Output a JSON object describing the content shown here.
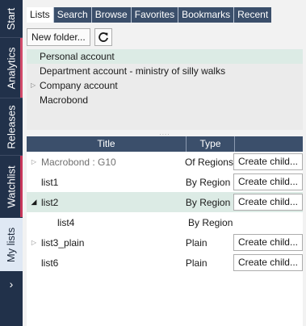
{
  "side_tabs": [
    {
      "label": "Start",
      "accent": ""
    },
    {
      "label": "Analytics",
      "accent": "#d24a6a"
    },
    {
      "label": "Releases",
      "accent": ""
    },
    {
      "label": "Watchlist",
      "accent": "#c7365a"
    },
    {
      "label": "My lists",
      "accent": "",
      "active": true
    }
  ],
  "expand_glyph": "›",
  "tabs": [
    "Lists",
    "Search",
    "Browse",
    "Favorites",
    "Bookmarks",
    "Recent"
  ],
  "active_tab": "Lists",
  "toolbar": {
    "new_folder_label": "New folder...",
    "refresh_icon": "refresh-icon"
  },
  "accounts": [
    {
      "label": "Personal account",
      "selected": true,
      "expandable": false
    },
    {
      "label": "Department account - ministry of silly walks",
      "selected": false,
      "expandable": false
    },
    {
      "label": "Company account",
      "selected": false,
      "expandable": true
    },
    {
      "label": "Macrobond",
      "selected": false,
      "expandable": false
    }
  ],
  "splitter": "....",
  "grid": {
    "headers": {
      "title": "Title",
      "type": "Type"
    },
    "rows": [
      {
        "title": "Macrobond : G10",
        "type": "Of Regions",
        "action": "Create child...",
        "expander": "closed",
        "muted": true,
        "indent": 0
      },
      {
        "title": "list1",
        "type": "By Region",
        "action": "Create child...",
        "expander": "",
        "muted": false,
        "indent": 0
      },
      {
        "title": "list2",
        "type": "By Region",
        "action": "Create child...",
        "expander": "open",
        "muted": false,
        "indent": 0,
        "selected": true
      },
      {
        "title": "list4",
        "type": "By Region",
        "action": "",
        "expander": "",
        "muted": false,
        "indent": 1
      },
      {
        "title": "list3_plain",
        "type": "Plain",
        "action": "Create child...",
        "expander": "closed",
        "muted": false,
        "indent": 0
      },
      {
        "title": "list6",
        "type": "Plain",
        "action": "Create child...",
        "expander": "",
        "muted": false,
        "indent": 0
      }
    ]
  }
}
